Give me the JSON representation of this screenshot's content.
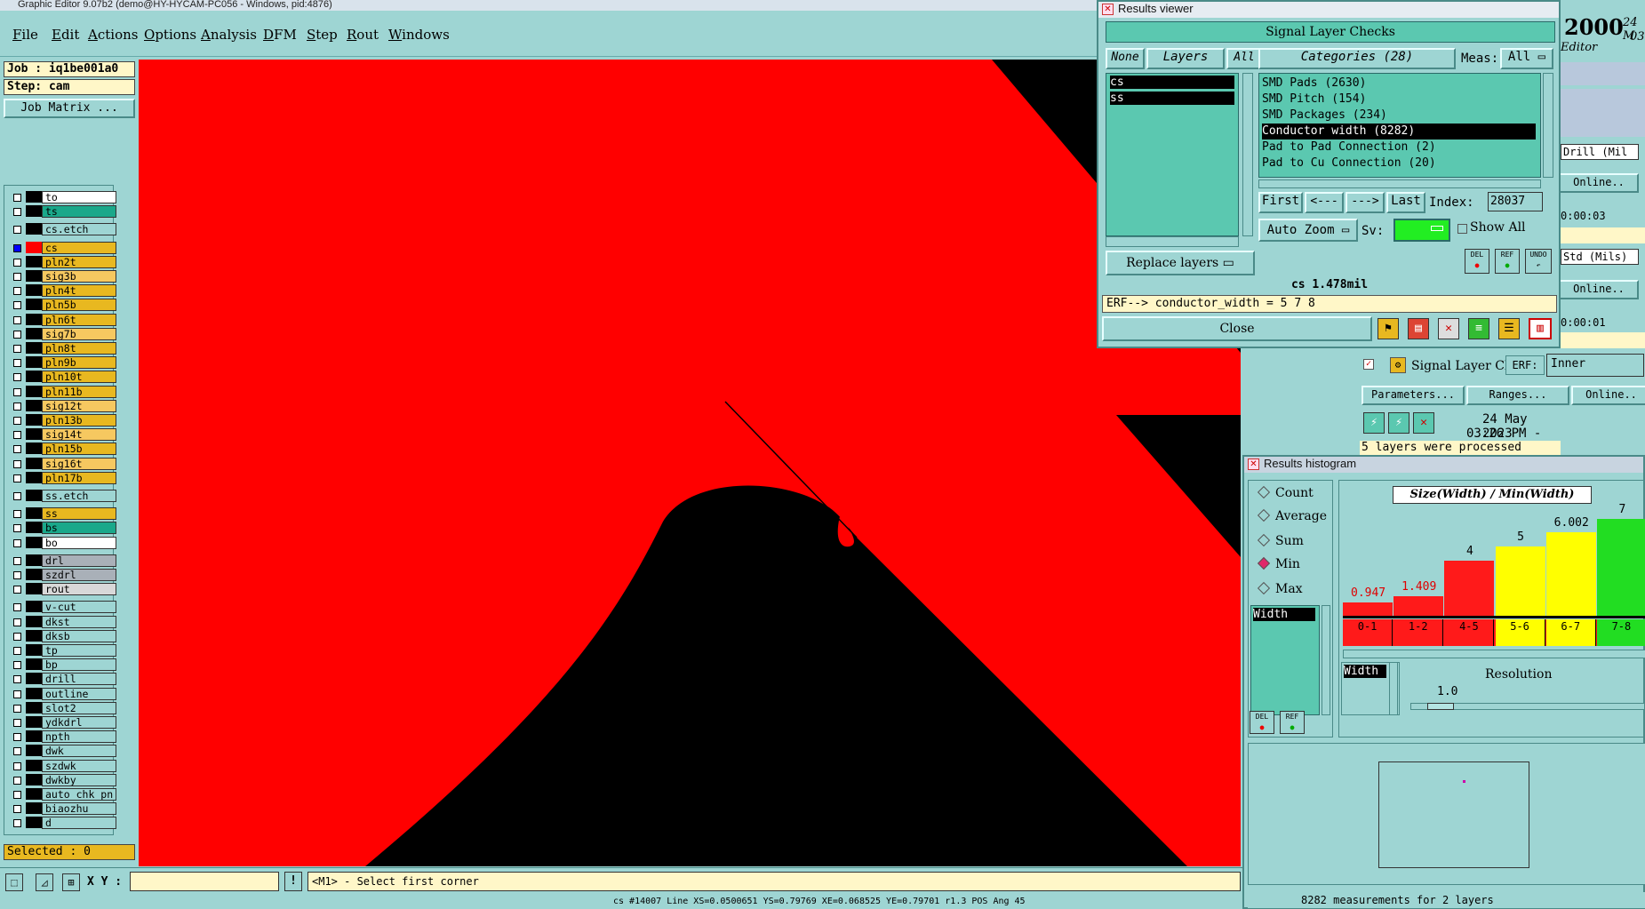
{
  "titlebar": {
    "title": "Graphic Editor 9.07b2 (demo@HY-HYCAM-PC056 - Windows, pid:4876)"
  },
  "menu": [
    "File",
    "Edit",
    "Actions",
    "Options",
    "Analysis",
    "DFM",
    "Step",
    "Rout",
    "Windows"
  ],
  "left": {
    "job": "Job : iq1be001a0",
    "step": "Step: cam",
    "job_matrix": "Job Matrix ...",
    "selected": "Selected : 0"
  },
  "layers": [
    {
      "name": "to",
      "color": "#ffffff"
    },
    {
      "name": "ts",
      "color": "#1aa88a"
    },
    {
      "name": "cs.etch",
      "color": "#9ed5d3"
    },
    {
      "name": "cs",
      "color": "#e8b820"
    },
    {
      "name": "pln2t",
      "color": "#e8b820"
    },
    {
      "name": "sig3b",
      "color": "#f6c860"
    },
    {
      "name": "pln4t",
      "color": "#e8b820"
    },
    {
      "name": "pln5b",
      "color": "#e8b820"
    },
    {
      "name": "pln6t",
      "color": "#e8b820"
    },
    {
      "name": "sig7b",
      "color": "#f6c860"
    },
    {
      "name": "pln8t",
      "color": "#e8b820"
    },
    {
      "name": "pln9b",
      "color": "#e8b820"
    },
    {
      "name": "pln10t",
      "color": "#e8b820"
    },
    {
      "name": "pln11b",
      "color": "#e8b820"
    },
    {
      "name": "sig12t",
      "color": "#f6c860"
    },
    {
      "name": "pln13b",
      "color": "#e8b820"
    },
    {
      "name": "sig14t",
      "color": "#f6c860"
    },
    {
      "name": "pln15b",
      "color": "#e8b820"
    },
    {
      "name": "sig16t",
      "color": "#f6c860"
    },
    {
      "name": "pln17b",
      "color": "#e8b820"
    },
    {
      "name": "ss.etch",
      "color": "#9ed5d3"
    },
    {
      "name": "ss",
      "color": "#e8b820"
    },
    {
      "name": "bs",
      "color": "#1aa88a"
    },
    {
      "name": "bo",
      "color": "#ffffff"
    },
    {
      "name": "drl",
      "color": "#a9b0b8"
    },
    {
      "name": "szdrl",
      "color": "#a9b0b8"
    },
    {
      "name": "rout",
      "color": "#d8d8d8"
    },
    {
      "name": "v-cut",
      "color": "#9ed5d3"
    },
    {
      "name": "dkst",
      "color": "#9ed5d3"
    },
    {
      "name": "dksb",
      "color": "#9ed5d3"
    },
    {
      "name": "tp",
      "color": "#9ed5d3"
    },
    {
      "name": "bp",
      "color": "#9ed5d3"
    },
    {
      "name": "drill",
      "color": "#9ed5d3"
    },
    {
      "name": "outline",
      "color": "#9ed5d3"
    },
    {
      "name": "slot2",
      "color": "#9ed5d3"
    },
    {
      "name": "ydkdrl",
      "color": "#9ed5d3"
    },
    {
      "name": "npth",
      "color": "#9ed5d3"
    },
    {
      "name": "dwk",
      "color": "#9ed5d3"
    },
    {
      "name": "szdwk",
      "color": "#9ed5d3"
    },
    {
      "name": "dwkby",
      "color": "#9ed5d3"
    },
    {
      "name": "auto_chk_pn",
      "color": "#9ed5d3"
    },
    {
      "name": "biaozhu",
      "color": "#9ed5d3"
    },
    {
      "name": "d",
      "color": "#9ed5d3"
    }
  ],
  "status": {
    "xy_label": "X Y :",
    "xy_value": "",
    "prompt": "<M1> - Select first corner",
    "bottom": "cs #14007 Line XS=0.0500651 YS=0.79769 XE=0.068525 YE=0.79701 r1.3 POS Ang 45"
  },
  "results_viewer": {
    "title": "Results viewer",
    "header": "Signal Layer Checks",
    "none": "None",
    "layers_label": "Layers",
    "all": "All",
    "layer_items": [
      "cs",
      "ss"
    ],
    "categories_label": "Categories (28)",
    "meas_label": "Meas:",
    "meas_value": "All",
    "categories": [
      "SMD Pads (2630)",
      "SMD Pitch (154)",
      "SMD Packages (234)",
      "Conductor width (8282)",
      "Pad to Pad Connection (2)",
      "Pad to Cu Connection (20)"
    ],
    "selected_category": "Conductor width (8282)",
    "first": "First",
    "prev": "<---",
    "next": "--->",
    "last": "Last",
    "index_label": "Index:",
    "index_value": "28037",
    "auto_zoom": "Auto Zoom",
    "sv_label": "Sv:",
    "show_all": "Show All",
    "replace_layers": "Replace layers",
    "del": "DEL",
    "ref": "REF",
    "undo": "UNDO",
    "measurement": "cs 1.478mil",
    "erf": "ERF--> conductor_width = 5 7 8",
    "close": "Close"
  },
  "right_bg": {
    "year": "2000",
    "date_partial": "24 M",
    "time_partial": "03:",
    "editor": "Editor",
    "drill": "Drill (Mil",
    "online1": "Online..",
    "time1": "0:00:03",
    "std": "Std (Mils)",
    "online2": "Online..",
    "time2": "0:00:01",
    "signal_layer": "Signal Layer Ch",
    "erf_label": "ERF:",
    "erf_value": "Inner",
    "parameters": "Parameters...",
    "ranges": "Ranges...",
    "online3": "Online..",
    "date": "24 May 2023",
    "time3": "03:26 PM - 0:00:08",
    "processed": "5 layers were processed"
  },
  "histogram": {
    "title": "Results histogram",
    "modes": [
      "Count",
      "Average",
      "Sum",
      "Min",
      "Max"
    ],
    "selected_mode": "Min",
    "width_item": "Width",
    "chart_title": "Size(Width) / Min(Width)",
    "resolution_label": "Resolution",
    "resolution_value": "1.0",
    "footer": "8282 measurements for 2 layers",
    "del": "DEL",
    "ref": "REF"
  },
  "chart_data": {
    "type": "bar",
    "title": "Size(Width) / Min(Width)",
    "categories": [
      "0-1",
      "1-2",
      "4-5",
      "5-6",
      "6-7",
      "7-8"
    ],
    "values": [
      0.947,
      1.409,
      4,
      5,
      6.002,
      7
    ],
    "value_labels": [
      "0.947",
      "1.409",
      "4",
      "5",
      "6.002",
      "7"
    ],
    "colors": [
      "#ff1a1a",
      "#ff1a1a",
      "#ff1a1a",
      "#ffff00",
      "#ffff00",
      "#22dd22"
    ],
    "label_colors": [
      "#e00000",
      "#e00000",
      "#000000",
      "#000000",
      "#000000",
      "#000000"
    ],
    "ylim": [
      0,
      8
    ]
  }
}
